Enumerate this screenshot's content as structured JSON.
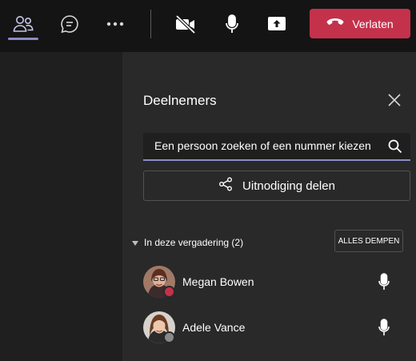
{
  "toolbar": {
    "items": [
      "participants-icon",
      "chat-icon",
      "more-icon",
      "camera-off-icon",
      "microphone-icon",
      "share-screen-icon"
    ],
    "leave_label": "Verlaten",
    "leave_color": "#c4314b",
    "accent_color": "#8b8cc7"
  },
  "panel": {
    "title": "Deelnemers",
    "search_placeholder": "Een persoon zoeken of een nummer kiezen",
    "share_label": "Uitnodiging delen",
    "section_label": "In deze vergadering (2)",
    "mute_all_label": "ALLES DEMPEN",
    "participants": [
      {
        "name": "Megan Bowen",
        "status": "busy",
        "status_color": "#c4314b"
      },
      {
        "name": "Adele Vance",
        "status": "offline",
        "status_color": "#8a8a8a"
      }
    ]
  }
}
